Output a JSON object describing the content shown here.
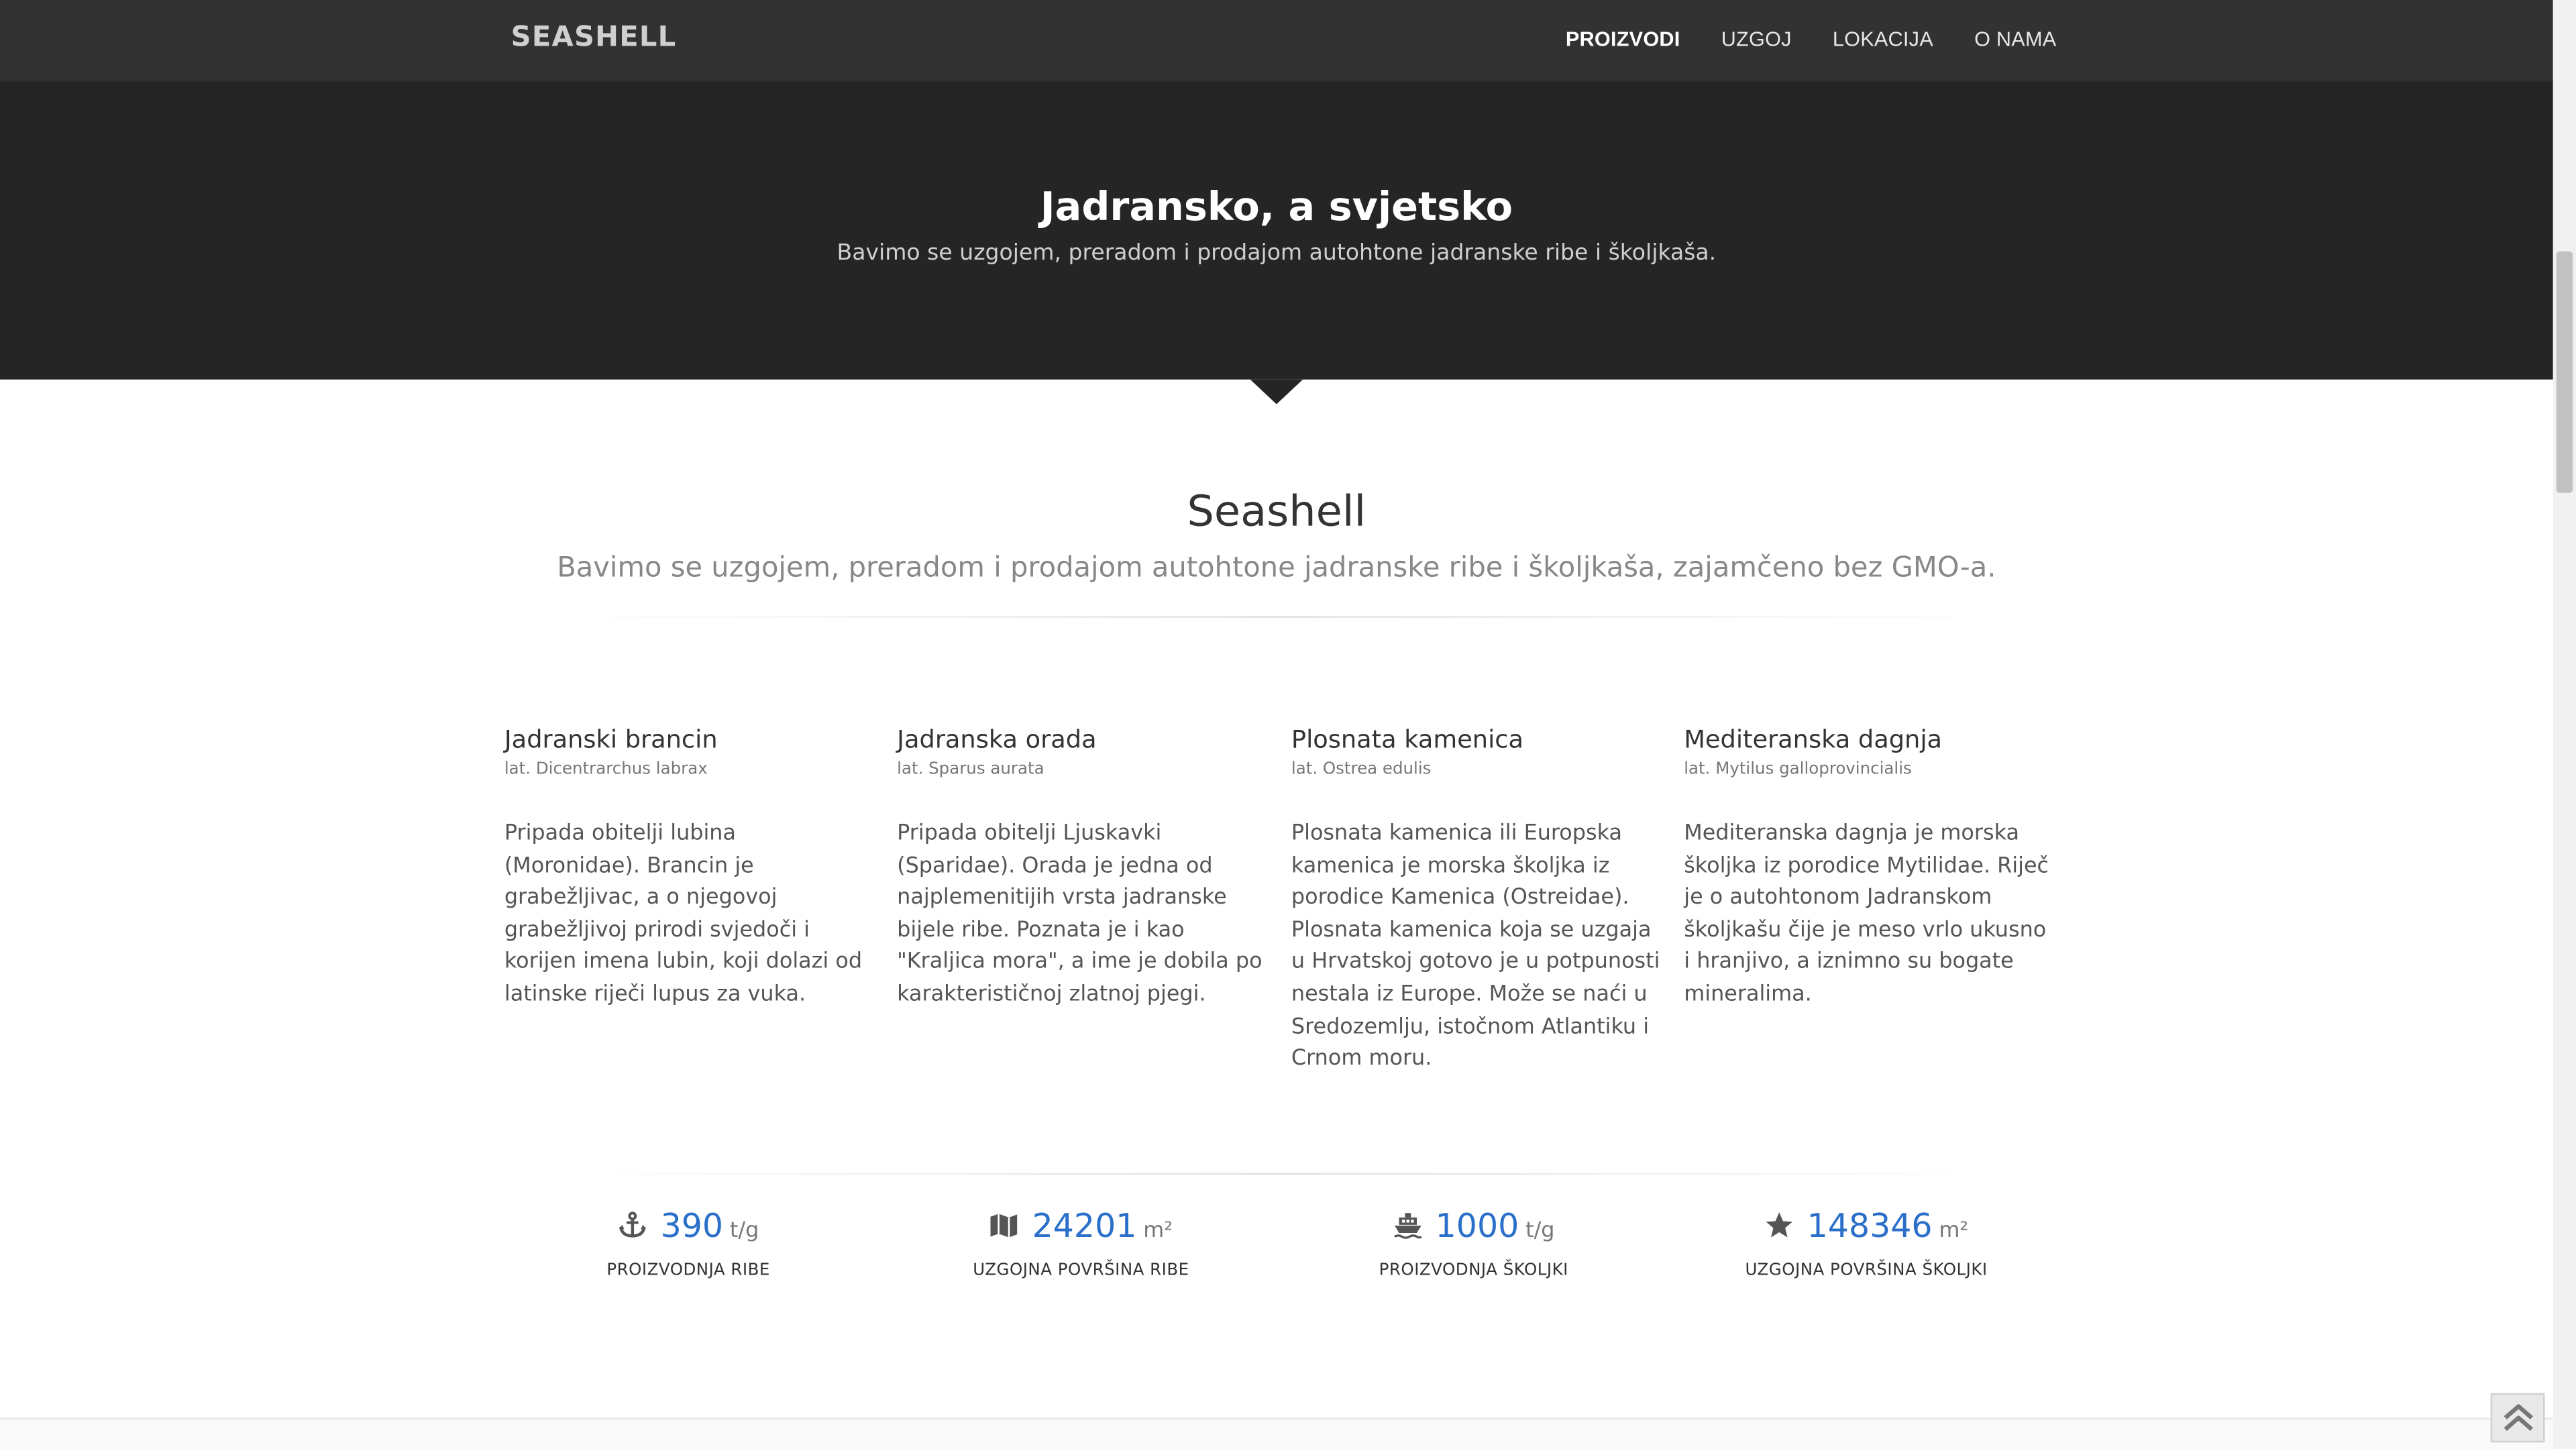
{
  "header": {
    "brand": "SEASHELL",
    "nav": [
      "PROIZVODI",
      "UZGOJ",
      "LOKACIJA",
      "O NAMA"
    ]
  },
  "hero": {
    "title": "Jadransko, a svjetsko",
    "subtitle": "Bavimo se uzgojem, preradom i prodajom autohtone jadranske ribe i školjkaša."
  },
  "section": {
    "title": "Seashell",
    "subtitle": "Bavimo se uzgojem, preradom i prodajom autohtone jadranske ribe i školjkaša, zajamčeno bez GMO-a."
  },
  "products": [
    {
      "name": "Jadranski brancin",
      "latin": "lat. Dicentrarchus labrax",
      "description": "Pripada obitelji lubina (Moronidae). Brancin je grabežljivac, a o njegovoj grabežljivoj prirodi svjedoči i korijen imena lubin, koji dolazi od latinske riječi lupus za vuka."
    },
    {
      "name": "Jadranska orada",
      "latin": "lat. Sparus aurata",
      "description": "Pripada obitelji Ljuskavki (Sparidae). Orada je jedna od najplemenitijih vrsta jadranske bijele ribe. Poznata je i kao \"Kraljica mora\", a ime je dobila po karakterističnoj zlatnoj pjegi."
    },
    {
      "name": "Plosnata kamenica",
      "latin": "lat. Ostrea edulis",
      "description": "Plosnata kamenica ili Europska kamenica je morska školjka iz porodice Kamenica (Ostreidae). Plosnata kamenica koja se uzgaja u Hrvatskoj gotovo je u potpunosti nestala iz Europe. Može se naći u Sredozemlju, istočnom Atlantiku i Crnom moru."
    },
    {
      "name": "Mediteranska dagnja",
      "latin": "lat. Mytilus galloprovincialis",
      "description": "Mediteranska dagnja je morska školjka iz porodice Mytilidae. Riječ je o autohtonom Jadranskom školjkašu čije je meso vrlo ukusno i hranjivo, a iznimno su bogate mineralima."
    }
  ],
  "stats": [
    {
      "icon": "anchor-icon",
      "value": "390",
      "unit": "t/g",
      "label": "PROIZVODNJA RIBE"
    },
    {
      "icon": "map-icon",
      "value": "24201",
      "unit": "m²",
      "label": "UZGOJNA POVRŠINA RIBE"
    },
    {
      "icon": "ship-icon",
      "value": "1000",
      "unit": "t/g",
      "label": "PROIZVODNJA ŠKOLJKI"
    },
    {
      "icon": "star-icon",
      "value": "148346",
      "unit": "m²",
      "label": "UZGOJNA POVRŠINA ŠKOLJKI"
    }
  ],
  "colors": {
    "topbar": "#323232",
    "hero": "#252525",
    "accent_number": "#2a6fc9"
  }
}
